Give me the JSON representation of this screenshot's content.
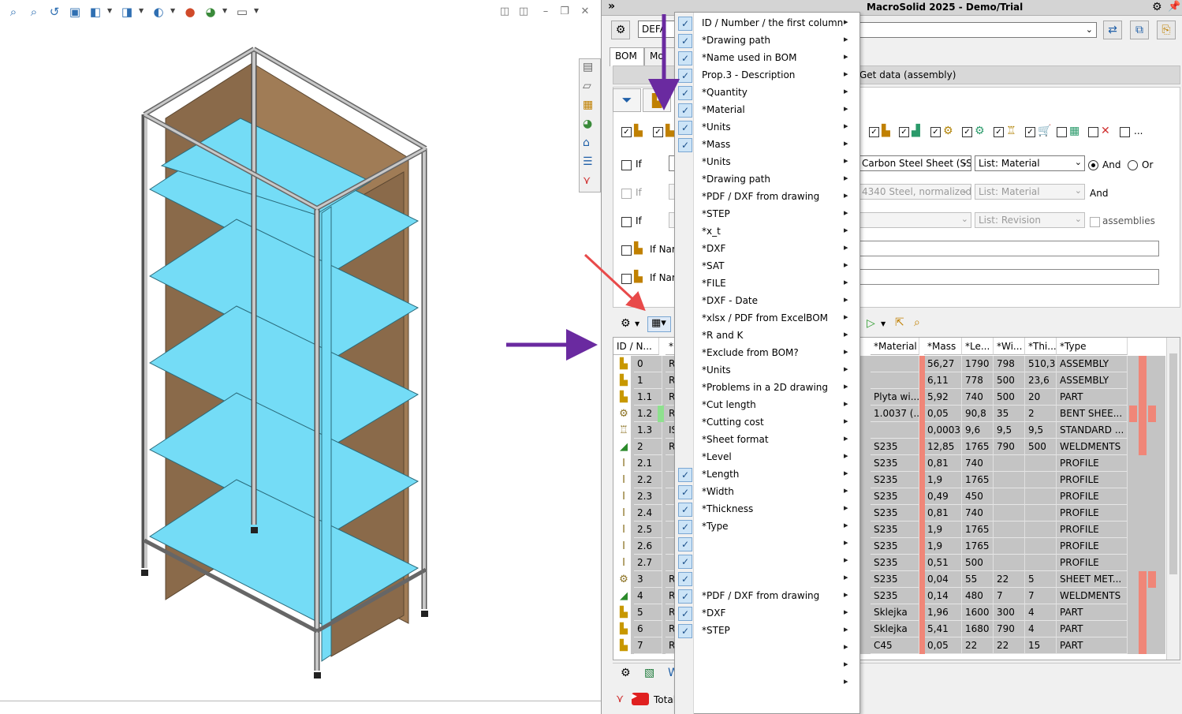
{
  "panel": {
    "title": "MacroSolid 2025 - Demo/Trial",
    "default_select": "DEFA",
    "tabs": [
      "BOM",
      "Moj"
    ],
    "getdata_label": "Get data (assembly)"
  },
  "filters": {
    "row1": {
      "if": "If",
      "material_value": "Carbon Steel Sheet (SS)",
      "list_value": "List: Material",
      "and": "And",
      "or": "Or"
    },
    "row2": {
      "if": "If",
      "material_value": "4340 Steel, normalized",
      "list_value": "List: Material",
      "and": "And"
    },
    "row3": {
      "if": "If",
      "list_value": "List: Revision",
      "assemblies": "assemblies"
    },
    "row4": {
      "label": "If Nam"
    },
    "row5": {
      "label": "If Nam"
    }
  },
  "grid": {
    "headers": [
      "ID / N...",
      "*N",
      "*Material",
      "*Mass",
      "*Le...",
      "*Wi...",
      "*Thi...",
      "*Type"
    ],
    "rows": [
      {
        "id": "0",
        "n": "R",
        "material": "",
        "mass": "56,27",
        "length": "1790",
        "width": "798",
        "thickness": "510,3",
        "type": "ASSEMBLY",
        "icon": "assembly",
        "red": [
          1
        ]
      },
      {
        "id": "1",
        "n": "R",
        "material": "",
        "mass": "6,11",
        "length": "778",
        "width": "500",
        "thickness": "23,6",
        "type": "ASSEMBLY",
        "icon": "assembly",
        "red": [
          1
        ]
      },
      {
        "id": "1.1",
        "n": "R",
        "material": "Plyta wi...",
        "mass": "5,92",
        "length": "740",
        "width": "500",
        "thickness": "20",
        "type": "PART",
        "icon": "part",
        "red": [
          1
        ]
      },
      {
        "id": "1.2",
        "n": "R",
        "material": "1.0037 (...",
        "mass": "0,05",
        "length": "90,8",
        "width": "35",
        "thickness": "2",
        "type": "BENT SHEE...",
        "icon": "sheet",
        "red": [
          0,
          1,
          2
        ],
        "green": true
      },
      {
        "id": "1.3",
        "n": "IS",
        "material": "",
        "mass": "0,0003",
        "length": "9,6",
        "width": "9,5",
        "thickness": "9,5",
        "type": "STANDARD ...",
        "icon": "standard",
        "red": [
          1
        ]
      },
      {
        "id": "2",
        "n": "R",
        "material": "S235",
        "mass": "12,85",
        "length": "1765",
        "width": "790",
        "thickness": "500",
        "type": "WELDMENTS",
        "icon": "weldment",
        "red": [
          1
        ]
      },
      {
        "id": "2.1",
        "n": "",
        "material": "S235",
        "mass": "0,81",
        "length": "740",
        "width": "",
        "thickness": "",
        "type": "PROFILE",
        "icon": "profile",
        "red": []
      },
      {
        "id": "2.2",
        "n": "",
        "material": "S235",
        "mass": "1,9",
        "length": "1765",
        "width": "",
        "thickness": "",
        "type": "PROFILE",
        "icon": "profile",
        "red": []
      },
      {
        "id": "2.3",
        "n": "",
        "material": "S235",
        "mass": "0,49",
        "length": "450",
        "width": "",
        "thickness": "",
        "type": "PROFILE",
        "icon": "profile",
        "red": []
      },
      {
        "id": "2.4",
        "n": "",
        "material": "S235",
        "mass": "0,81",
        "length": "740",
        "width": "",
        "thickness": "",
        "type": "PROFILE",
        "icon": "profile",
        "red": []
      },
      {
        "id": "2.5",
        "n": "",
        "material": "S235",
        "mass": "1,9",
        "length": "1765",
        "width": "",
        "thickness": "",
        "type": "PROFILE",
        "icon": "profile",
        "red": []
      },
      {
        "id": "2.6",
        "n": "",
        "material": "S235",
        "mass": "1,9",
        "length": "1765",
        "width": "",
        "thickness": "",
        "type": "PROFILE",
        "icon": "profile",
        "red": []
      },
      {
        "id": "2.7",
        "n": "",
        "material": "S235",
        "mass": "0,51",
        "length": "500",
        "width": "",
        "thickness": "",
        "type": "PROFILE",
        "icon": "profile",
        "red": []
      },
      {
        "id": "3",
        "n": "R",
        "material": "S235",
        "mass": "0,04",
        "length": "55",
        "width": "22",
        "thickness": "5",
        "type": "SHEET MET...",
        "icon": "sheet",
        "red": [
          1,
          2
        ]
      },
      {
        "id": "4",
        "n": "R",
        "material": "S235",
        "mass": "0,14",
        "length": "480",
        "width": "7",
        "thickness": "7",
        "type": "WELDMENTS",
        "icon": "weldment",
        "red": [
          1
        ]
      },
      {
        "id": "5",
        "n": "R",
        "material": "Sklejka",
        "mass": "1,96",
        "length": "1600",
        "width": "300",
        "thickness": "4",
        "type": "PART",
        "icon": "part",
        "red": [
          1
        ]
      },
      {
        "id": "6",
        "n": "R",
        "material": "Sklejka",
        "mass": "5,41",
        "length": "1680",
        "width": "790",
        "thickness": "4",
        "type": "PART",
        "icon": "part",
        "red": [
          1
        ]
      },
      {
        "id": "7",
        "n": "R",
        "material": "C45",
        "mass": "0,05",
        "length": "22",
        "width": "22",
        "thickness": "15",
        "type": "PART",
        "icon": "part",
        "red": [
          1
        ]
      }
    ]
  },
  "totals_label": "Total:",
  "menu": {
    "items": [
      {
        "label": "ID / Number / the first column",
        "checked": true
      },
      {
        "label": "*Drawing path",
        "checked": true
      },
      {
        "label": "*Name used in BOM",
        "checked": true
      },
      {
        "label": "Prop.3 - Description",
        "checked": true
      },
      {
        "label": "*Quantity",
        "checked": true
      },
      {
        "label": "*Material",
        "checked": true
      },
      {
        "label": "*Units",
        "checked": true
      },
      {
        "label": "*Mass",
        "checked": true
      },
      {
        "label": "*Units",
        "checked": false
      },
      {
        "label": "*Drawing path",
        "checked": false
      },
      {
        "label": "*PDF / DXF from drawing",
        "checked": false
      },
      {
        "label": "*STEP",
        "checked": false
      },
      {
        "label": "*x_t",
        "checked": false
      },
      {
        "label": "*DXF",
        "checked": false
      },
      {
        "label": "*SAT",
        "checked": false
      },
      {
        "label": "*FILE",
        "checked": false
      },
      {
        "label": "*DXF - Date",
        "checked": false
      },
      {
        "label": "*xlsx / PDF from ExcelBOM",
        "checked": false
      },
      {
        "label": "*R and K",
        "checked": false
      },
      {
        "label": "*Exclude from BOM?",
        "checked": false
      },
      {
        "label": "*Units",
        "checked": false
      },
      {
        "label": "*Problems in a 2D drawing",
        "checked": false
      },
      {
        "label": "*Cut length",
        "checked": false
      },
      {
        "label": "*Cutting cost",
        "checked": false
      },
      {
        "label": "*Sheet format",
        "checked": false
      },
      {
        "label": "*Level",
        "checked": false
      },
      {
        "label": "*Length",
        "checked": true
      },
      {
        "label": "*Width",
        "checked": true
      },
      {
        "label": "*Thickness",
        "checked": true
      },
      {
        "label": "*Type",
        "checked": true
      },
      {
        "label": "",
        "checked": true
      },
      {
        "label": "",
        "checked": true
      },
      {
        "label": "",
        "checked": true
      },
      {
        "label": "*PDF / DXF from drawing",
        "checked": true
      },
      {
        "label": "*DXF",
        "checked": true
      },
      {
        "label": "*STEP",
        "checked": true
      },
      {
        "label": "",
        "checked": false
      },
      {
        "label": "",
        "checked": false
      },
      {
        "label": "",
        "checked": false
      }
    ]
  },
  "colors": {
    "accent": "#1f5fa8",
    "mass_strip": "#f08678",
    "cyan_shelf": "#74dcf6",
    "wood": "#8a6a4a",
    "frame": "#c8c8c8",
    "annotation_purple": "#6a2aa0",
    "annotation_red": "#e84a4a"
  }
}
